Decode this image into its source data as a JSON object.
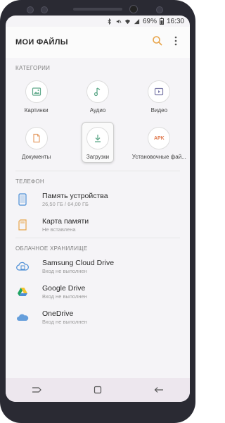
{
  "status_bar": {
    "battery": "69%",
    "time": "16:30"
  },
  "header": {
    "title": "МОИ ФАЙЛЫ"
  },
  "categories": {
    "label": "КАТЕГОРИИ",
    "items": [
      {
        "label": "Картинки",
        "icon": "image-icon"
      },
      {
        "label": "Аудио",
        "icon": "music-note-icon"
      },
      {
        "label": "Видео",
        "icon": "video-icon"
      },
      {
        "label": "Документы",
        "icon": "document-icon"
      },
      {
        "label": "Загрузки",
        "icon": "download-icon"
      },
      {
        "label": "Установочные фай...",
        "icon": "apk-icon"
      }
    ]
  },
  "phone_section": {
    "label": "ТЕЛЕФОН",
    "items": [
      {
        "title": "Память устройства",
        "subtitle": "26,50 ГБ / 64,00 ГБ"
      },
      {
        "title": "Карта памяти",
        "subtitle": "Не вставлена"
      }
    ]
  },
  "cloud_section": {
    "label": "ОБЛАЧНОЕ ХРАНИЛИЩЕ",
    "items": [
      {
        "title": "Samsung Cloud Drive",
        "subtitle": "Вход не выполнен"
      },
      {
        "title": "Google Drive",
        "subtitle": "Вход не выполнен"
      },
      {
        "title": "OneDrive",
        "subtitle": "Вход не выполнен"
      }
    ]
  },
  "colors": {
    "accent": "#e8a44a",
    "icon_green": "#5fa98a",
    "icon_blue": "#4b8ed6",
    "apk_orange": "#e07a4f"
  }
}
